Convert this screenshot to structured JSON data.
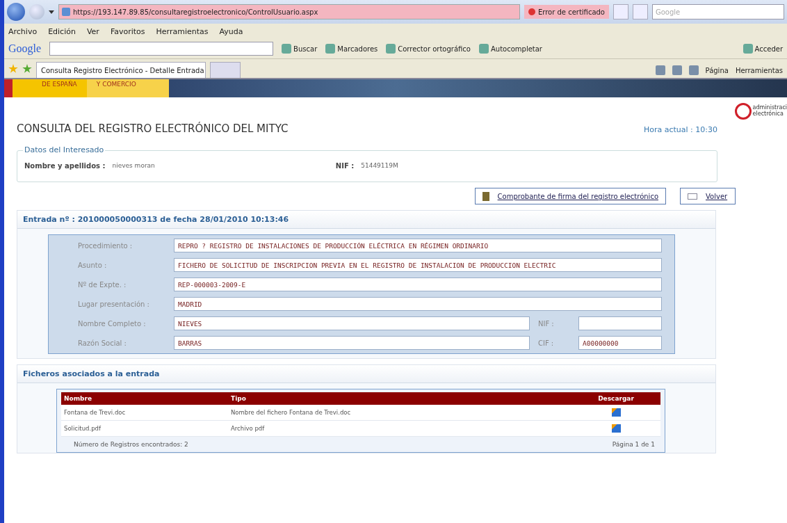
{
  "browser": {
    "address": "https://193.147.89.85/consultaregistroelectronico/ControlUsuario.aspx",
    "cert_error": "Error de certificado",
    "search_placeholder": "Google",
    "menu": [
      "Archivo",
      "Edición",
      "Ver",
      "Favoritos",
      "Herramientas",
      "Ayuda"
    ],
    "google_toolbar": {
      "brand": "Google",
      "buttons": [
        "Buscar",
        "Marcadores",
        "Corrector ortográfico",
        "Autocompletar",
        "Acceder"
      ]
    },
    "tabs": [
      {
        "title": "Consulta Registro Electrónico - Detalle Entrada",
        "selected": true
      }
    ],
    "command_bar": [
      "Página",
      "Herramientas"
    ]
  },
  "banner": {
    "texts": [
      "DE ESPAÑA",
      "Y COMERCIO"
    ]
  },
  "logo": {
    "lines": [
      "administraci",
      "electrónica"
    ]
  },
  "title": "CONSULTA DEL REGISTRO ELECTRÓNICO DEL MITYC",
  "time": "Hora actual : 10:30",
  "interesado": {
    "legend": "Datos del Interesado",
    "fields": [
      {
        "label": "Nombre y apellidos :",
        "value": "nieves moran"
      },
      {
        "label": "NIF :",
        "value": "51449119M"
      }
    ]
  },
  "actions": [
    {
      "kind": "receipt",
      "label": "Comprobante de firma del registro electrónico"
    },
    {
      "kind": "back",
      "label": "Volver"
    }
  ],
  "entrada": {
    "title": "Entrada nº : 201000050000313 de fecha 28/01/2010 10:13:46",
    "fields": [
      {
        "label": "Procedimiento :",
        "value": "REPRO ? REGISTRO DE INSTALACIONES DE PRODUCCIÓN ELÉCTRICA EN RÉGIMEN ORDINARIO"
      },
      {
        "label": "Asunto :",
        "value": "FICHERO DE SOLICITUD DE INSCRIPCION PREVIA EN EL REGISTRO DE INSTALACION DE PRODUCCION ELECTRIC"
      },
      {
        "label": "Nº de Expte. :",
        "value": "REP-000003-2009-E"
      },
      {
        "label": "Lugar presentación :",
        "value": "MADRID"
      },
      {
        "label": "Nombre Completo :",
        "value": "NIEVES",
        "side": {
          "label": "NIF :"
        }
      },
      {
        "label": "Razón Social :",
        "value": "BARRAS",
        "side": {
          "label": "CIF :",
          "value": "A00000000"
        }
      }
    ]
  },
  "ficheros": {
    "title": "Ficheros asociados a la entrada",
    "columns": [
      "Nombre",
      "Tipo",
      "Descargar"
    ],
    "rows": [
      {
        "nombre": "Fontana de Trevi.doc",
        "tipo": "Nombre del fichero Fontana de Trevi.doc"
      },
      {
        "nombre": "Solicitud.pdf",
        "tipo": "Archivo pdf"
      }
    ],
    "count": "Número de Registros encontrados: 2",
    "pages": "Página 1 de 1"
  }
}
